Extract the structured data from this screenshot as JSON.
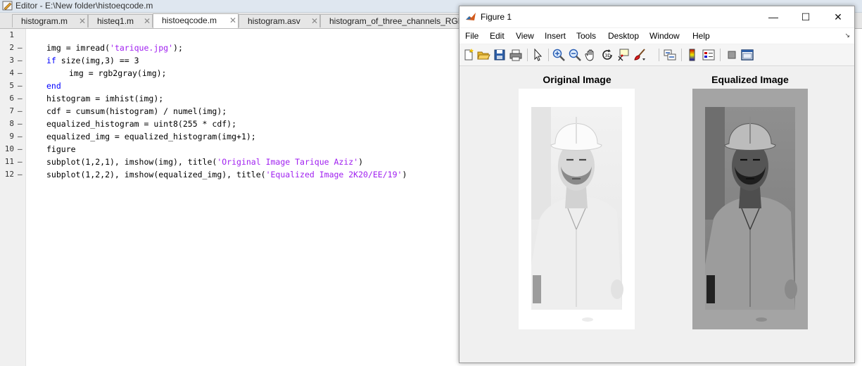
{
  "editor": {
    "title": "Editor - E:\\New folder\\histoeqcode.m",
    "tabs": [
      {
        "label": "histogram.m",
        "close": "✕"
      },
      {
        "label": "histeq1.m",
        "close": "✕"
      },
      {
        "label": "histoeqcode.m",
        "close": "✕"
      },
      {
        "label": "histogram.asv",
        "close": "✕"
      },
      {
        "label": "histogram_of_three_channels_RGB_i"
      }
    ],
    "line_numbers": [
      "1",
      "2",
      "3",
      "4",
      "5",
      "6",
      "7",
      "8",
      "9",
      "10",
      "11",
      "12"
    ],
    "line_marker": "—",
    "code": {
      "l2a": "img = imread(",
      "l2s": "'tarique.jpg'",
      "l2b": ");",
      "l3k": "if",
      "l3b": " size(img,3) == 3",
      "l4": "img = rgb2gray(img);",
      "l5": "end",
      "l6": "histogram = imhist(img);",
      "l7": "cdf = cumsum(histogram) / numel(img);",
      "l8": "equalized_histogram = uint8(255 * cdf);",
      "l9": "equalized_img = equalized_histogram(img+1);",
      "l10": "figure",
      "l11a": "subplot(1,2,1), imshow(img), title(",
      "l11s": "'Original Image Tarique Aziz'",
      "l11b": ")",
      "l12a": "subplot(1,2,2), imshow(equalized_img), title(",
      "l12s": "'Equalized Image 2K20/EE/19'",
      "l12b": ")"
    }
  },
  "figure": {
    "title": "Figure 1",
    "window_buttons": {
      "minimize": "—",
      "maximize": "☐",
      "close": "✕"
    },
    "menu": [
      "File",
      "Edit",
      "View",
      "Insert",
      "Tools",
      "Desktop",
      "Window",
      "Help"
    ],
    "dock_arrow": "↘",
    "toolbar_icons": [
      "new-figure-icon",
      "open-file-icon",
      "save-icon",
      "print-icon",
      "pointer-icon",
      "zoom-in-icon",
      "zoom-out-icon",
      "pan-icon",
      "rotate-3d-icon",
      "data-cursor-icon",
      "brush-icon",
      "link-plot-icon",
      "colorbar-icon",
      "legend-icon",
      "hide-plot-tools-icon",
      "show-plot-tools-icon"
    ],
    "axes": [
      {
        "title": "Original Image"
      },
      {
        "title": "Equalized Image"
      }
    ]
  },
  "colors": {
    "keyword": "#0000ff",
    "string": "#a020f0",
    "figure_bg": "#f0f0f0"
  }
}
